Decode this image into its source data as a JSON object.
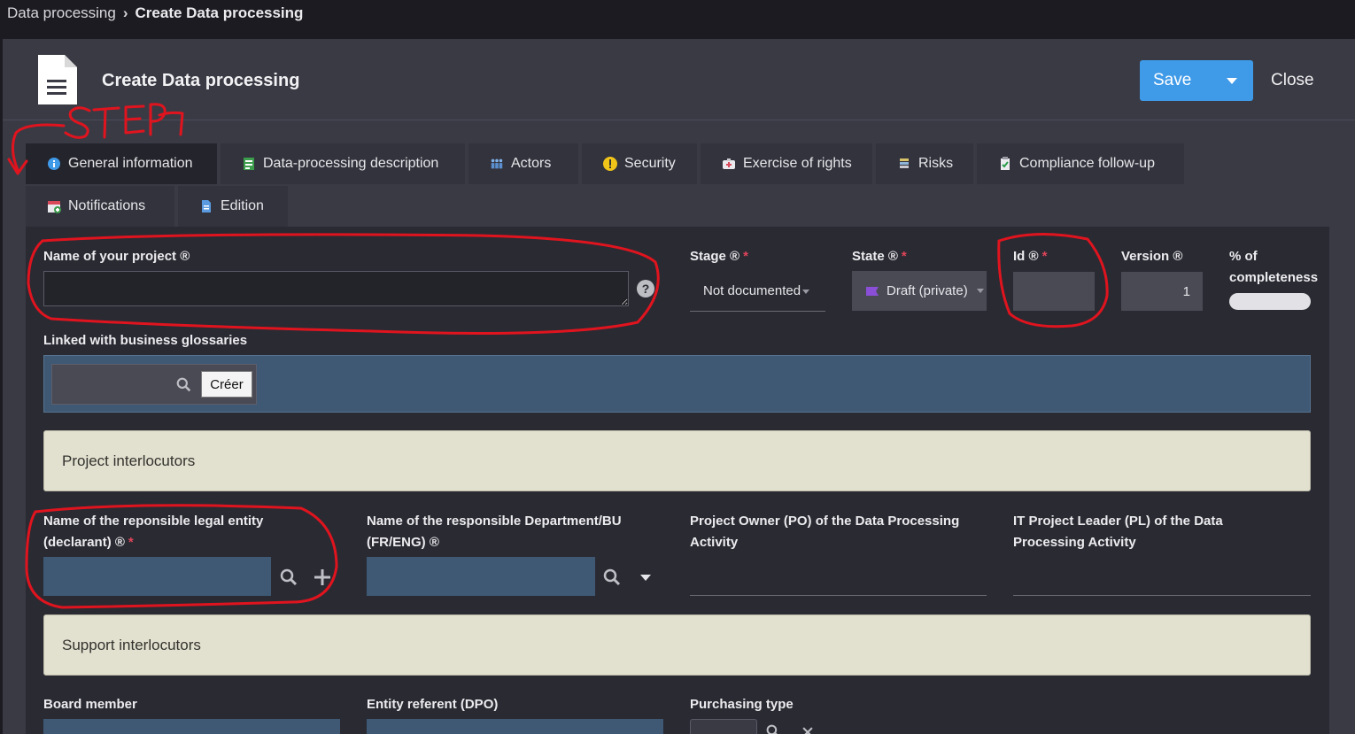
{
  "breadcrumb": {
    "parent": "Data processing",
    "current": "Create Data processing"
  },
  "header": {
    "title": "Create Data processing",
    "save_label": "Save",
    "close_label": "Close"
  },
  "tabs": [
    {
      "label": "General information",
      "icon": "info-icon",
      "active": true
    },
    {
      "label": "Data-processing description",
      "icon": "spreadsheet-icon"
    },
    {
      "label": "Actors",
      "icon": "people-icon"
    },
    {
      "label": "Security",
      "icon": "warning-icon"
    },
    {
      "label": "Exercise of rights",
      "icon": "medical-kit-icon"
    },
    {
      "label": "Risks",
      "icon": "stack-icon"
    },
    {
      "label": "Compliance follow-up",
      "icon": "clipboard-check-icon"
    },
    {
      "label": "Notifications",
      "icon": "calendar-add-icon"
    },
    {
      "label": "Edition",
      "icon": "document-icon"
    }
  ],
  "form": {
    "project_name_label": "Name of your project ®",
    "project_name_value": "",
    "help_glyph": "?",
    "stage_label": "Stage ®",
    "stage_value": "Not documented",
    "state_label": "State ®",
    "state_value": "Draft (private)",
    "id_label": "Id ®",
    "id_value": "",
    "version_label": "Version ®",
    "version_value": "1",
    "completeness_label_1": "% of",
    "completeness_label_2": "completeness",
    "glossary_label": "Linked with business glossaries",
    "glossary_create_label": "Créer",
    "required_marker": "*",
    "project_interlocutors": "Project interlocutors",
    "legal_entity_label_1": "Name of the reponsible legal entity",
    "legal_entity_label_2": "(declarant) ®",
    "department_label_1": "Name of the responsible Department/BU",
    "department_label_2": "(FR/ENG) ®",
    "po_label_1": "Project Owner (PO) of the Data Processing",
    "po_label_2": "Activity",
    "pl_label_1": "IT Project Leader (PL) of the Data",
    "pl_label_2": "Processing Activity",
    "support_interlocutors": "Support interlocutors",
    "board_member_label": "Board member",
    "entity_referent_label": "Entity referent (DPO)",
    "purchasing_type_label": "Purchasing type"
  },
  "annotation": {
    "step_text": "STEP 1",
    "color": "#e0141e"
  },
  "colors": {
    "accent": "#3f9ae8",
    "section_bg": "#e2e0cf",
    "input_blue": "#3f5974"
  }
}
